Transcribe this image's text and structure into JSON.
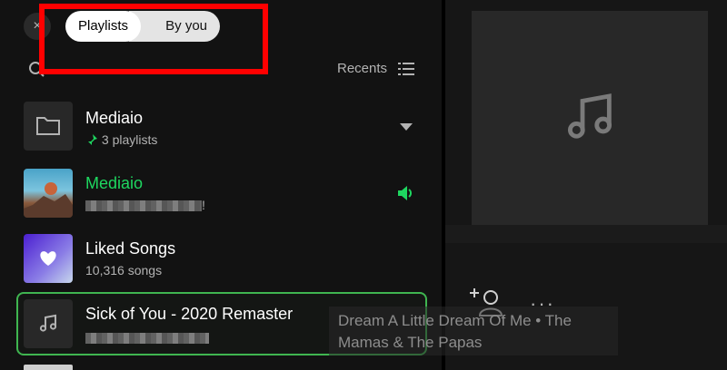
{
  "library": {
    "close_icon": "×",
    "filters": {
      "playlists": "Playlists",
      "by_you": "By you"
    },
    "sort_label": "Recents",
    "items": [
      {
        "title": "Mediaio",
        "subtitle": "3 playlists",
        "type": "folder",
        "expanded_icon": "caret-down"
      },
      {
        "title": "Mediaio",
        "subtitle_suffix": "!",
        "type": "playlist",
        "playing": true
      },
      {
        "title": "Liked Songs",
        "subtitle": "10,316 songs",
        "type": "liked"
      },
      {
        "title": "Sick of You - 2020 Remaster",
        "type": "track"
      }
    ]
  },
  "drag_overlay": {
    "text": "Dream A Little Dream Of Me • The Mamas & The Papas"
  },
  "now_playing": {
    "more_label": "···"
  },
  "colors": {
    "accent": "#1ed760",
    "highlight": "#ff0000",
    "selection_border": "#3fb550"
  }
}
